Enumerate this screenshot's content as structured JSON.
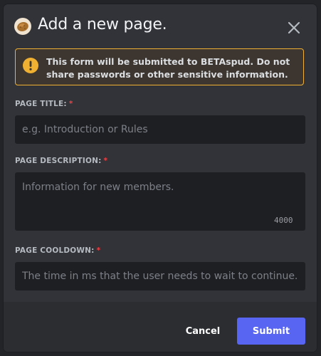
{
  "modal": {
    "title": "Add a new page.",
    "app_icon": "potato-icon",
    "close_icon": "close-icon"
  },
  "warning": {
    "icon": "warning-icon",
    "accent_color": "#f0b132",
    "text_prefix": "This form will be submitted to ",
    "app_name": "BETAspud",
    "text_suffix": ". Do not share passwords or other sensitive information."
  },
  "fields": {
    "title": {
      "label": "PAGE TITLE:",
      "required_mark": "*",
      "value": "",
      "placeholder": "e.g. Introduction or Rules"
    },
    "description": {
      "label": "PAGE DESCRIPTION:",
      "required_mark": "*",
      "value": "",
      "placeholder": "Information for new members.",
      "char_limit": "4000"
    },
    "cooldown": {
      "label": "PAGE COOLDOWN:",
      "required_mark": "*",
      "value": "",
      "placeholder": "The time in ms that the user needs to wait to continue."
    }
  },
  "footer": {
    "cancel_label": "Cancel",
    "submit_label": "Submit",
    "submit_color": "#5865f2"
  }
}
